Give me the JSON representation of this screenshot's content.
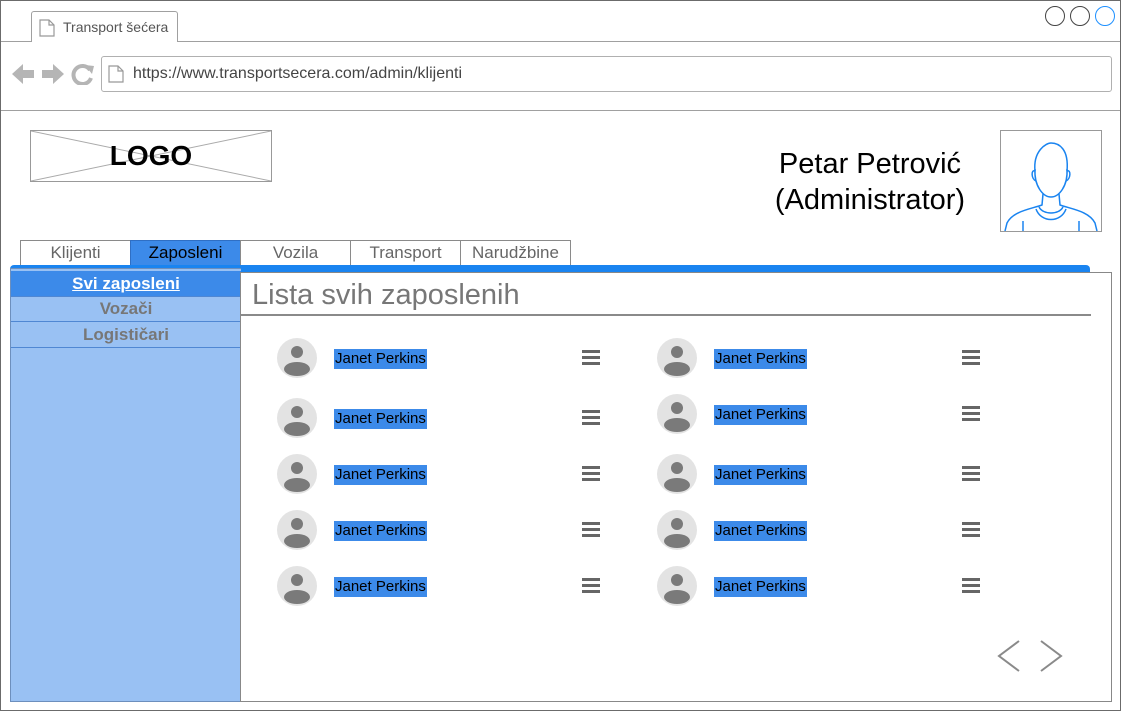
{
  "browser": {
    "tab_title": "Transport šećera",
    "url": "https://www.transportsecera.com/admin/klijenti"
  },
  "header": {
    "logo_text": "LOGO",
    "user_name": "Petar Petrović",
    "user_role": "(Administrator)"
  },
  "main_tabs": [
    "Klijenti",
    "Zaposleni",
    "Vozila",
    "Transport",
    "Narudžbine"
  ],
  "active_main_tab": "Zaposleni",
  "sidebar": {
    "items": [
      "Svi zaposleni",
      "Vozači",
      "Logističari"
    ],
    "active": "Svi zaposleni"
  },
  "content": {
    "title": "Lista svih zaposlenih",
    "employees": [
      "Janet Perkins",
      "Janet Perkins",
      "Janet Perkins",
      "Janet Perkins",
      "Janet Perkins",
      "Janet Perkins",
      "Janet Perkins",
      "Janet Perkins",
      "Janet Perkins",
      "Janet Perkins"
    ]
  },
  "colors": {
    "accent": "#1a84f0",
    "active_tab": "#3c8ae9",
    "sidebar_bg": "#99c1f3",
    "highlight": "#3c8ae9"
  },
  "icons": [
    "doc-icon",
    "back-arrow-icon",
    "forward-arrow-icon",
    "reload-icon",
    "person-icon",
    "menu-icon",
    "chevron-left-icon",
    "chevron-right-icon"
  ]
}
